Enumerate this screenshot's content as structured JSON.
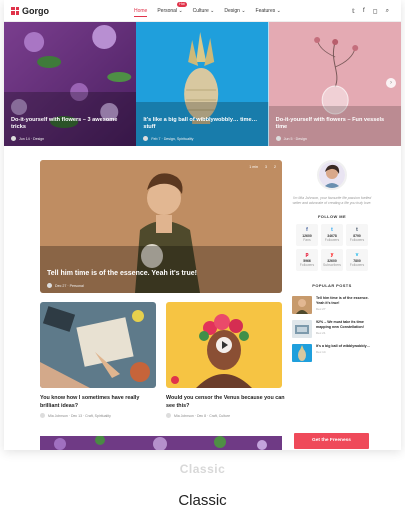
{
  "header": {
    "logo": "Gorgo",
    "nav": [
      {
        "label": "Home",
        "active": true
      },
      {
        "label": "Personal ⌄",
        "badge": "Hot"
      },
      {
        "label": "Culture ⌄"
      },
      {
        "label": "Design ⌄"
      },
      {
        "label": "Features ⌄"
      }
    ],
    "icons": [
      "twitter-icon",
      "facebook-icon",
      "instagram-icon",
      "search-icon"
    ]
  },
  "hero": [
    {
      "title": "Do-it-yourself with flowers – 3 awesome tricks",
      "meta": "Jun 14 · Design"
    },
    {
      "title": "It's like a big ball of wibblywobbly… time… stuff",
      "meta": "Feb 7 · Design, Spirituality"
    },
    {
      "title": "Do-it-yourself with flowers – Fun vessels time",
      "meta": "Jun 5 · Design"
    }
  ],
  "featured": {
    "title": "Tell him time is of the essence. Yeah it's true!",
    "meta": "Dec 27 · Personal",
    "stats": [
      "1 min",
      "3",
      "2"
    ]
  },
  "posts": [
    {
      "title": "You know how I sometimes have really brilliant ideas?",
      "meta": "Mia Johnson · Dec 13 · Craft, Spirituality"
    },
    {
      "title": "Would you censor the Venus because you can see this?",
      "meta": "Mia Johnson · Dec 8 · Craft, Culture"
    }
  ],
  "sidebar": {
    "bio": "I'm Mia Johnson, your favourite life passion fuelled writer and advocate of creating a life you truly love.",
    "follow_heading": "FOLLOW ME",
    "socials": [
      {
        "icon": "f",
        "count": "12600",
        "name": "Fans"
      },
      {
        "icon": "t",
        "count": "34678",
        "name": "Followers"
      },
      {
        "icon": "t",
        "count": "8790",
        "name": "Followers"
      },
      {
        "icon": "p",
        "count": "5966",
        "name": "Followers"
      },
      {
        "icon": "y",
        "count": "32600",
        "name": "Subscribers"
      },
      {
        "icon": "v",
        "count": "7800",
        "name": "Followers"
      }
    ],
    "popular_heading": "POPULAR POSTS",
    "popular": [
      {
        "title": "Tell him time is of the essence. Yeah it's true!",
        "date": "Dec 27"
      },
      {
        "title": "92% – We must take its time mapping new Constellation!",
        "date": "Dec 21"
      },
      {
        "title": "It's a big ball of wibblywobbly…",
        "date": "Dec 14"
      }
    ],
    "cta": "Get the Freeness"
  },
  "ghost_caption": "Classic",
  "caption": "Classic"
}
